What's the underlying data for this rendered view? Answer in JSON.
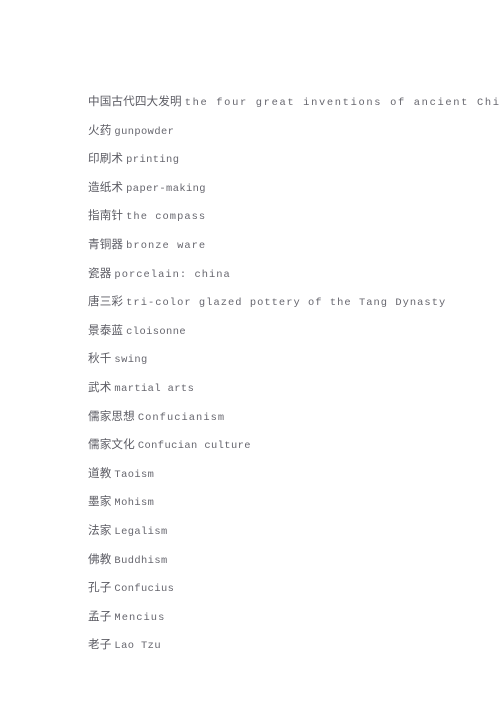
{
  "document": {
    "page_background": "#ffffff",
    "text_color": "#62626a",
    "title": "中国古代四大发明 the four great inventions of ancient China",
    "lines": [
      {
        "chinese": "中国古代四大发明",
        "english": "the four great inventions of ancient China"
      },
      {
        "chinese": "火药",
        "english": "gunpowder"
      },
      {
        "chinese": "印刷术",
        "english": "printing"
      },
      {
        "chinese": "造纸术",
        "english": "paper-making"
      },
      {
        "chinese": "指南针",
        "english": "the compass"
      },
      {
        "chinese": "青铜器",
        "english": "bronze ware"
      },
      {
        "chinese": "瓷器",
        "english": "porcelain: china"
      },
      {
        "chinese": "唐三彩",
        "english": "tri-color glazed pottery of the Tang Dynasty"
      },
      {
        "chinese": "景泰蓝",
        "english": "cloisonne"
      },
      {
        "chinese": "秋千",
        "english": "swing"
      },
      {
        "chinese": "武术",
        "english": "martial arts"
      },
      {
        "chinese": "儒家思想",
        "english": "Confucianism"
      },
      {
        "chinese": "儒家文化",
        "english": "Confucian culture"
      },
      {
        "chinese": "道教",
        "english": "Taoism"
      },
      {
        "chinese": "墨家",
        "english": "Mohism"
      },
      {
        "chinese": "法家",
        "english": "Legalism"
      },
      {
        "chinese": "佛教",
        "english": "Buddhism"
      },
      {
        "chinese": "孔子",
        "english": "Confucius"
      },
      {
        "chinese": "孟子",
        "english": "Mencius"
      },
      {
        "chinese": "老子",
        "english": "Lao Tzu"
      }
    ]
  }
}
